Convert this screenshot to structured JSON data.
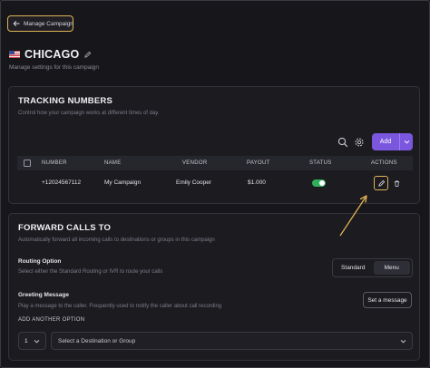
{
  "header": {
    "back_label": "Manage Campaign",
    "title": "CHICAGO",
    "subtitle": "Manage settings for this campaign"
  },
  "tracking": {
    "title": "TRACKING NUMBERS",
    "description": "Control how your campaign works at different times of day.",
    "add_label": "Add",
    "columns": [
      "NUMBER",
      "NAME",
      "VENDOR",
      "PAYOUT",
      "STATUS",
      "ACTIONS"
    ],
    "rows": [
      {
        "number": "+12024567112",
        "name": "My Campaign",
        "vendor": "Emily Cooper",
        "payout": "$1.000",
        "status": "on"
      }
    ]
  },
  "forward": {
    "title": "FORWARD CALLS TO",
    "description": "Automatically forward all incoming calls to destinations or groups in this campaign",
    "routing_label": "Routing Option",
    "routing_desc": "Select either the Standard Routing or IVR to route your calls",
    "routing_options": [
      "Standard",
      "Menu"
    ],
    "routing_selected": "Menu",
    "greeting_label": "Greeting Message",
    "greeting_desc": "Play a message to the caller. Frequently used to notify the caller about call recording",
    "greeting_button": "Set a message",
    "add_option_label": "ADD ANOTHER OPTION",
    "option_number": "1",
    "destination_placeholder": "Select a Destination or Group"
  },
  "colors": {
    "accent": "#7b57e0",
    "highlight": "#e0b255",
    "status_on": "#2fae5b",
    "background": "#17171b"
  },
  "icons": [
    "arrow-left-icon",
    "us-flag-icon",
    "pencil-icon",
    "search-icon",
    "gear-icon",
    "chevron-down-icon",
    "trash-icon"
  ]
}
